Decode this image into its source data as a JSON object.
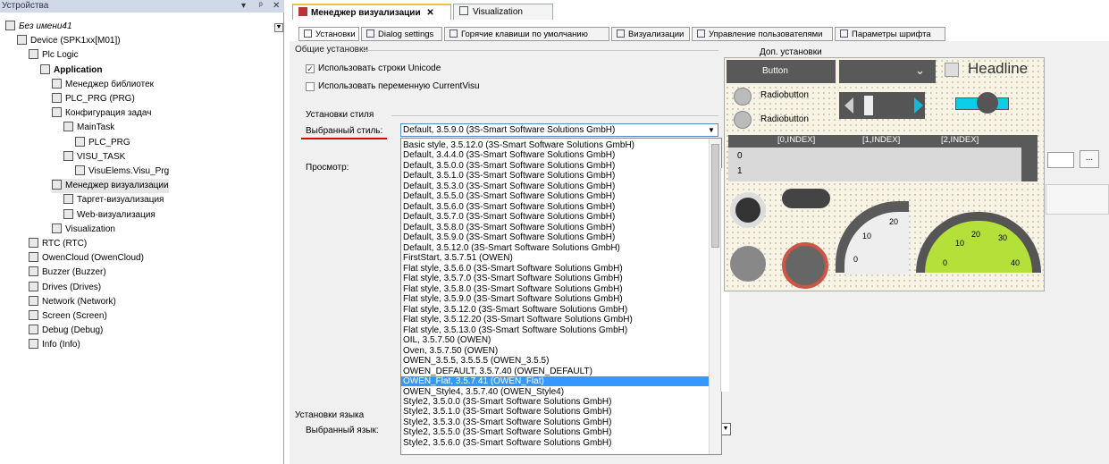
{
  "devices_panel": {
    "title": "Устройства",
    "controls": [
      "▾",
      "ᵖ",
      "✕"
    ],
    "tree": [
      {
        "label": "Без имени41",
        "level": 0,
        "italic": true
      },
      {
        "label": "Device (SPK1xx[M01])",
        "level": 1
      },
      {
        "label": "Plc Logic",
        "level": 2
      },
      {
        "label": "Application",
        "level": 3,
        "bold": true
      },
      {
        "label": "Менеджер библиотек",
        "level": 4
      },
      {
        "label": "PLC_PRG (PRG)",
        "level": 4
      },
      {
        "label": "Конфигурация задач",
        "level": 4
      },
      {
        "label": "MainTask",
        "level": 5
      },
      {
        "label": "PLC_PRG",
        "level": 6
      },
      {
        "label": "VISU_TASK",
        "level": 5
      },
      {
        "label": "VisuElems.Visu_Prg",
        "level": 6
      },
      {
        "label": "Менеджер визуализации",
        "level": 4
      },
      {
        "label": "Таргет-визуализация",
        "level": 5
      },
      {
        "label": "Web-визуализация",
        "level": 5
      },
      {
        "label": "Visualization",
        "level": 4
      },
      {
        "label": "RTC (RTC)",
        "level": 2
      },
      {
        "label": "OwenCloud (OwenCloud)",
        "level": 2
      },
      {
        "label": "Buzzer (Buzzer)",
        "level": 2
      },
      {
        "label": "Drives (Drives)",
        "level": 2
      },
      {
        "label": "Network (Network)",
        "level": 2
      },
      {
        "label": "Screen (Screen)",
        "level": 2
      },
      {
        "label": "Debug (Debug)",
        "level": 2
      },
      {
        "label": "Info (Info)",
        "level": 2
      }
    ]
  },
  "doc_tabs": [
    {
      "label": "Менеджер визуализации",
      "close": "✕",
      "active": true
    },
    {
      "label": "Visualization",
      "active": false
    }
  ],
  "sub_tabs": [
    "Установки",
    "Dialog settings",
    "Горячие клавиши по умолчанию",
    "Визуализации",
    "Управление пользователями",
    "Параметры шрифта"
  ],
  "general": {
    "title": "Общие установки",
    "unicode_label": "Использовать строки Unicode",
    "unicode_checked": true,
    "currentvisu_label": "Использовать переменную CurrentVisu",
    "currentvisu_checked": false
  },
  "extra_title": "Доп. установки",
  "style": {
    "title": "Установки стиля",
    "selected_label": "Выбранный стиль:",
    "selected_value": "Default, 3.5.9.0 (3S-Smart Software Solutions GmbH)",
    "preview_label": "Просмотр:",
    "options": [
      "Basic style, 3.5.12.0 (3S-Smart Software Solutions GmbH)",
      "Default, 3.4.4.0 (3S-Smart Software Solutions GmbH)",
      "Default, 3.5.0.0 (3S-Smart Software Solutions GmbH)",
      "Default, 3.5.1.0 (3S-Smart Software Solutions GmbH)",
      "Default, 3.5.3.0 (3S-Smart Software Solutions GmbH)",
      "Default, 3.5.5.0 (3S-Smart Software Solutions GmbH)",
      "Default, 3.5.6.0 (3S-Smart Software Solutions GmbH)",
      "Default, 3.5.7.0 (3S-Smart Software Solutions GmbH)",
      "Default, 3.5.8.0 (3S-Smart Software Solutions GmbH)",
      "Default, 3.5.9.0 (3S-Smart Software Solutions GmbH)",
      "Default, 3.5.12.0 (3S-Smart Software Solutions GmbH)",
      "FirstStart, 3.5.7.51 (OWEN)",
      "Flat style, 3.5.6.0 (3S-Smart Software Solutions GmbH)",
      "Flat style, 3.5.7.0 (3S-Smart Software Solutions GmbH)",
      "Flat style, 3.5.8.0 (3S-Smart Software Solutions GmbH)",
      "Flat style, 3.5.9.0 (3S-Smart Software Solutions GmbH)",
      "Flat style, 3.5.12.0 (3S-Smart Software Solutions GmbH)",
      "Flat style, 3.5.12.20 (3S-Smart Software Solutions GmbH)",
      "Flat style, 3.5.13.0 (3S-Smart Software Solutions GmbH)",
      "OIL, 3.5.7.50 (OWEN)",
      "Oven, 3.5.7.50 (OWEN)",
      "OWEN_3.5.5, 3.5.5.5 (OWEN_3.5.5)",
      "OWEN_DEFAULT, 3.5.7.40 (OWEN_DEFAULT)",
      "OWEN_Flat, 3.5.7.41 (OWEN_Flat)",
      "OWEN_Style4, 3.5.7.40 (OWEN_Style4)",
      "Style2, 3.5.0.0 (3S-Smart Software Solutions GmbH)",
      "Style2, 3.5.1.0 (3S-Smart Software Solutions GmbH)",
      "Style2, 3.5.3.0 (3S-Smart Software Solutions GmbH)",
      "Style2, 3.5.5.0 (3S-Smart Software Solutions GmbH)",
      "Style2, 3.5.6.0 (3S-Smart Software Solutions GmbH)"
    ],
    "highlighted_index": 23
  },
  "language": {
    "title": "Установки языка",
    "selected_label": "Выбранный язык:"
  },
  "browse_btn": "...",
  "preview": {
    "button": "Button",
    "headline": "Headline",
    "radio1": "Radiobutton",
    "radio2": "Radiobutton",
    "table_headers": [
      "[0,INDEX]",
      "[1,INDEX]",
      "[2,INDEX]"
    ],
    "table_rows": [
      "0",
      "1"
    ],
    "gauge1_ticks": [
      "0",
      "10",
      "20"
    ],
    "gauge2_ticks": [
      "0",
      "10",
      "20",
      "30",
      "40"
    ]
  },
  "colors": {
    "accent": "#3399ff",
    "underline": "#e00000",
    "panel_header": "#cfd9e8"
  }
}
